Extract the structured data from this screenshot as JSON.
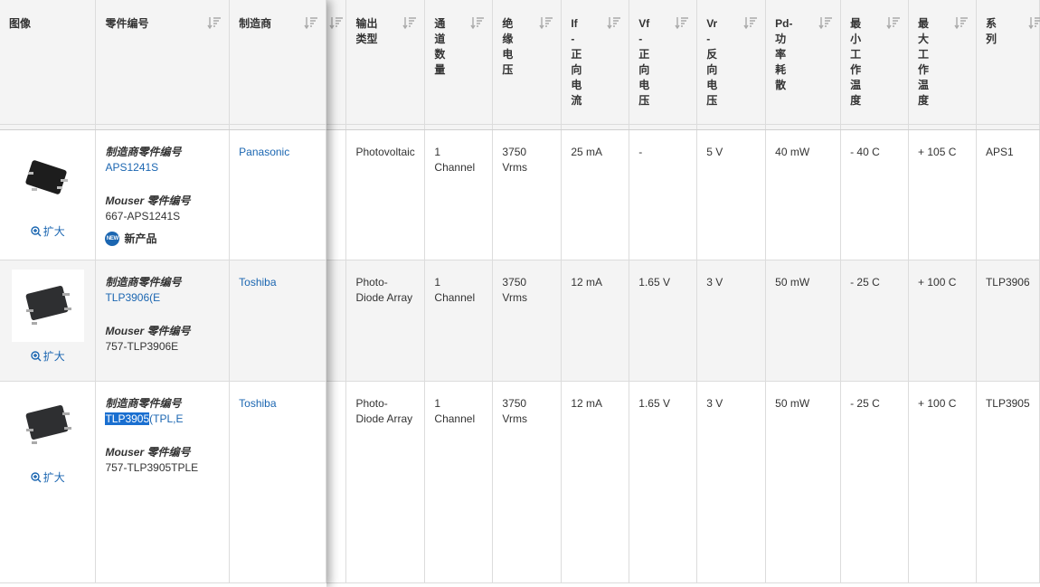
{
  "headers": {
    "image": "图像",
    "part_no": "零件编号",
    "manufacturer": "制造商",
    "output_type": "输出\n类型",
    "channels": "通\n道\n数\n量",
    "isolation_voltage": "绝\n缘\n电\n压",
    "if_forward_current": "If\n-\n正\n向\n电\n流",
    "vf_forward_voltage": "Vf\n-\n正\n向\n电\n压",
    "vr_reverse_voltage": "Vr\n-\n反\n向\n电\n压",
    "pd_power": "Pd-\n功\n率\n耗\n散",
    "min_temp": "最\n小\n工\n作\n温\n度",
    "max_temp": "最\n大\n工\n作\n温\n度",
    "series": "系\n列"
  },
  "labels": {
    "mfr_part_label": "制造商零件编号",
    "mouser_part_label": "Mouser 零件编号",
    "enlarge": "扩大",
    "new_product": "新产品",
    "new_badge_text": "NEW"
  },
  "rows": [
    {
      "mfr_part": "APS1241S",
      "mouser_part": "667-APS1241S",
      "manufacturer": "Panasonic",
      "is_new": true,
      "output_type": "Photovoltaic",
      "channels": "1\nChannel",
      "isolation_voltage": "3750\nVrms",
      "if": "25 mA",
      "vf": "-",
      "vr": "5 V",
      "pd": "40 mW",
      "min_temp": "- 40 C",
      "max_temp": "+ 105 C",
      "series": "APS1"
    },
    {
      "mfr_part": "TLP3906(E",
      "mouser_part": "757-TLP3906E",
      "manufacturer": "Toshiba",
      "is_new": false,
      "output_type": "Photo-\nDiode Array",
      "channels": "1\nChannel",
      "isolation_voltage": "3750\nVrms",
      "if": "12 mA",
      "vf": "1.65 V",
      "vr": "3 V",
      "pd": "50 mW",
      "min_temp": "- 25 C",
      "max_temp": "+ 100 C",
      "series": "TLP3906"
    },
    {
      "mfr_part_selected": "TLP3905",
      "mfr_part_rest": "(TPL,E",
      "mouser_part": "757-TLP3905TPLE",
      "manufacturer": "Toshiba",
      "is_new": false,
      "output_type": "Photo-\nDiode Array",
      "channels": "1\nChannel",
      "isolation_voltage": "3750\nVrms",
      "if": "12 mA",
      "vf": "1.65 V",
      "vr": "3 V",
      "pd": "50 mW",
      "min_temp": "- 25 C",
      "max_temp": "+ 100 C",
      "series": "TLP3905"
    }
  ]
}
